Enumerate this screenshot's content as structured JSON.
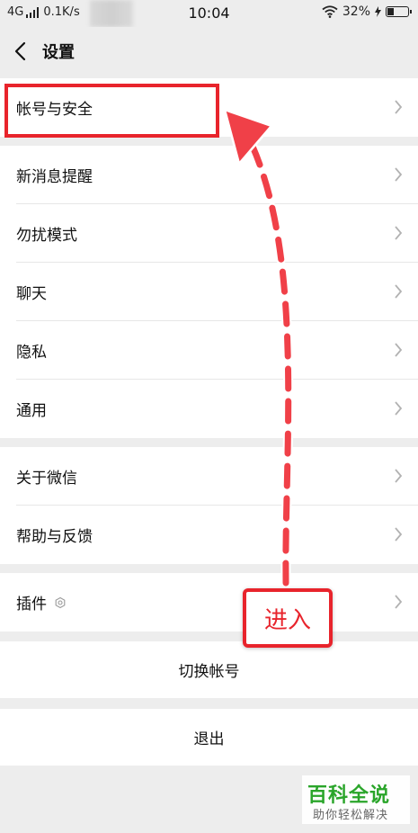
{
  "status_bar": {
    "network": "4G",
    "speed": "0.1K/s",
    "time": "10:04",
    "battery": "32%"
  },
  "nav": {
    "title": "设置"
  },
  "groups": [
    {
      "items": [
        {
          "label": "帐号与安全"
        }
      ]
    },
    {
      "items": [
        {
          "label": "新消息提醒"
        },
        {
          "label": "勿扰模式"
        },
        {
          "label": "聊天"
        },
        {
          "label": "隐私"
        },
        {
          "label": "通用"
        }
      ]
    },
    {
      "items": [
        {
          "label": "关于微信"
        },
        {
          "label": "帮助与反馈"
        }
      ]
    },
    {
      "items": [
        {
          "label": "插件"
        }
      ]
    }
  ],
  "buttons": {
    "switch_account": "切换帐号",
    "logout": "退出"
  },
  "annotation": {
    "text": "进入",
    "color": "#e8242c"
  },
  "watermark": {
    "title": "百科全说",
    "subtitle": "助你轻松解决"
  },
  "colors": {
    "background": "#ededed",
    "highlight": "#e8242c",
    "watermark": "#2aa52a"
  }
}
